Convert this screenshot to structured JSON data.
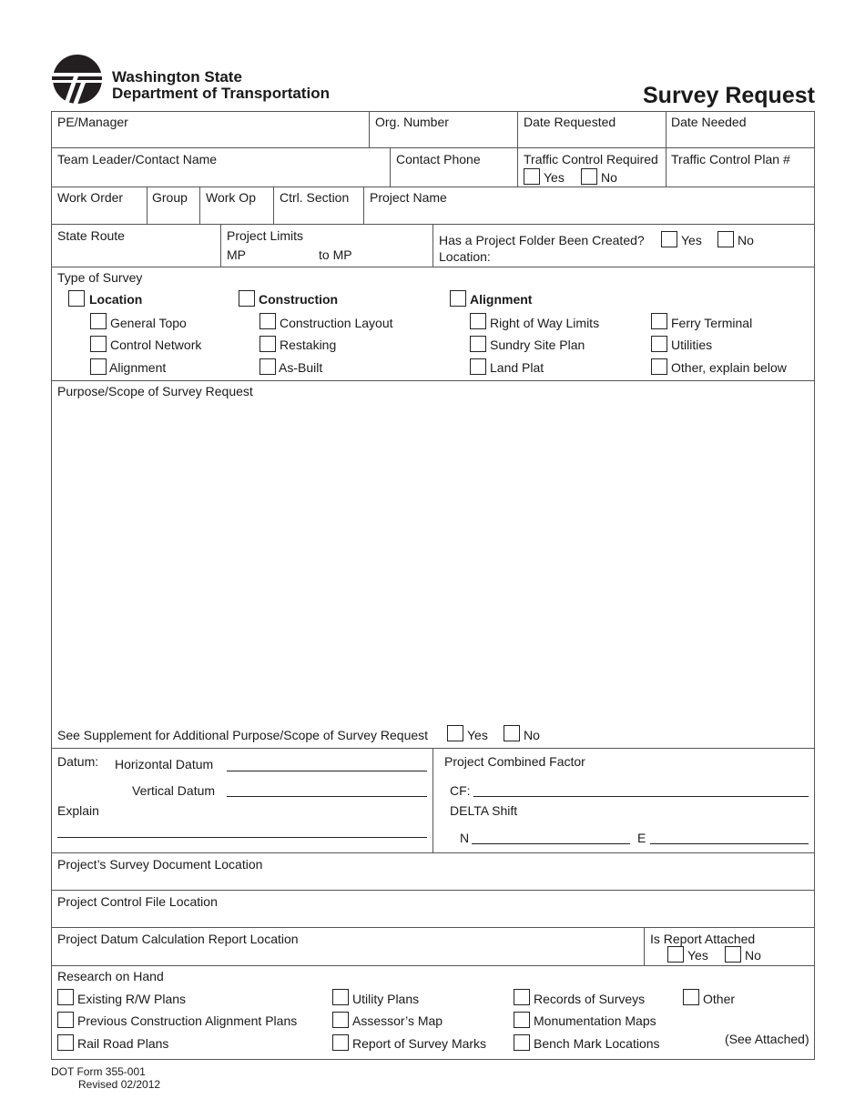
{
  "header": {
    "org_line1": "Washington State",
    "org_line2": "Department of Transportation",
    "form_title": "Survey Request",
    "logo_icon": "wsdot-logo-icon"
  },
  "row1": {
    "pe_manager": "PE/Manager",
    "org_number": "Org. Number",
    "date_requested": "Date Requested",
    "date_needed": "Date Needed"
  },
  "row2": {
    "team_leader": "Team Leader/Contact Name",
    "contact_phone": "Contact Phone",
    "traffic_control_required": "Traffic Control Required",
    "yes": "Yes",
    "no": "No",
    "traffic_control_plan": "Traffic Control Plan #"
  },
  "row3": {
    "work_order": "Work Order",
    "group": "Group",
    "work_op": "Work Op",
    "ctrl_section": "Ctrl. Section",
    "project_name": "Project Name"
  },
  "row4": {
    "state_route": "State Route",
    "project_limits": "Project Limits",
    "mp": "MP",
    "to_mp": "to MP",
    "folder_question": "Has a Project Folder Been Created?",
    "yes": "Yes",
    "no": "No",
    "location": "Location:"
  },
  "type_of_survey": {
    "heading": "Type of Survey",
    "groups": [
      {
        "label": "Location",
        "items": [
          "General Topo",
          "Control Network",
          "Alignment"
        ]
      },
      {
        "label": "Construction",
        "items": [
          "Construction Layout",
          "Restaking",
          "As-Built"
        ]
      },
      {
        "label": "Alignment",
        "items": [
          "Right of Way Limits",
          "Sundry Site Plan",
          "Land Plat"
        ]
      },
      {
        "label": "",
        "items": [
          "Ferry Terminal",
          "Utilities",
          "Other, explain below"
        ]
      }
    ]
  },
  "purpose": {
    "heading": "Purpose/Scope of Survey Request",
    "supplement": "See Supplement for Additional Purpose/Scope of Survey Request",
    "yes": "Yes",
    "no": "No"
  },
  "datum": {
    "label": "Datum:",
    "horizontal": "Horizontal Datum",
    "vertical": "Vertical Datum",
    "explain": "Explain",
    "combined_factor": "Project Combined Factor",
    "cf": "CF:",
    "delta_shift": "DELTA Shift",
    "n": "N",
    "e": "E"
  },
  "locations": {
    "survey_document": "Project’s Survey Document Location",
    "control_file": "Project Control File Location",
    "datum_calc_report": "Project Datum Calculation Report Location",
    "report_attached": "Is Report Attached",
    "yes": "Yes",
    "no": "No"
  },
  "research": {
    "heading": "Research on Hand",
    "columns": [
      [
        "Existing R/W Plans",
        "Previous Construction Alignment Plans",
        "Rail Road Plans"
      ],
      [
        "Utility Plans",
        "Assessor’s Map",
        "Report of Survey Marks"
      ],
      [
        "Records of Surveys",
        "Monumentation Maps",
        "Bench Mark Locations"
      ],
      [
        "Other"
      ]
    ],
    "see_attached": "(See Attached)"
  },
  "footer": {
    "form_number": "DOT Form 355-001",
    "revised": "Revised 02/2012"
  }
}
